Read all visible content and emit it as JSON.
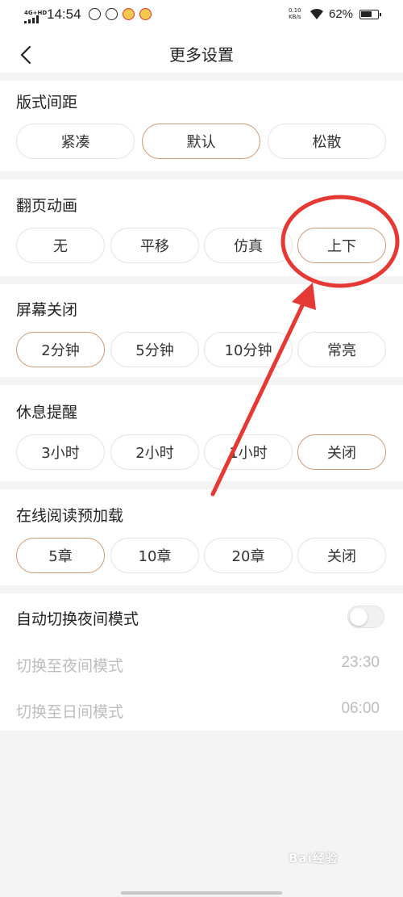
{
  "status_bar": {
    "network": "4G+HD",
    "time": "14:54",
    "net_speed_value": "0.10",
    "net_speed_unit": "KB/s",
    "battery": "62%"
  },
  "header": {
    "title": "更多设置"
  },
  "sections": [
    {
      "title": "版式间距",
      "options": [
        "紧凑",
        "默认",
        "松散"
      ],
      "selected": "默认"
    },
    {
      "title": "翻页动画",
      "options": [
        "无",
        "平移",
        "仿真",
        "上下"
      ],
      "selected": "上下"
    },
    {
      "title": "屏幕关闭",
      "options": [
        "2分钟",
        "5分钟",
        "10分钟",
        "常亮"
      ],
      "selected": "2分钟"
    },
    {
      "title": "休息提醒",
      "options": [
        "3小时",
        "2小时",
        "1小时",
        "关闭"
      ],
      "selected": "关闭"
    },
    {
      "title": "在线阅读预加载",
      "options": [
        "5章",
        "10章",
        "20章",
        "关闭"
      ],
      "selected": "5章"
    }
  ],
  "night_mode": {
    "label": "自动切换夜间模式",
    "enabled": false,
    "to_night_label": "切换至夜间模式",
    "to_night_time": "23:30",
    "to_day_label": "切换至日间模式",
    "to_day_time": "06:00"
  },
  "watermark": "Bai经验",
  "colors": {
    "selected_border": "#c99a74",
    "annotation_red": "#e53935",
    "disabled_text": "#bdbdbd"
  }
}
